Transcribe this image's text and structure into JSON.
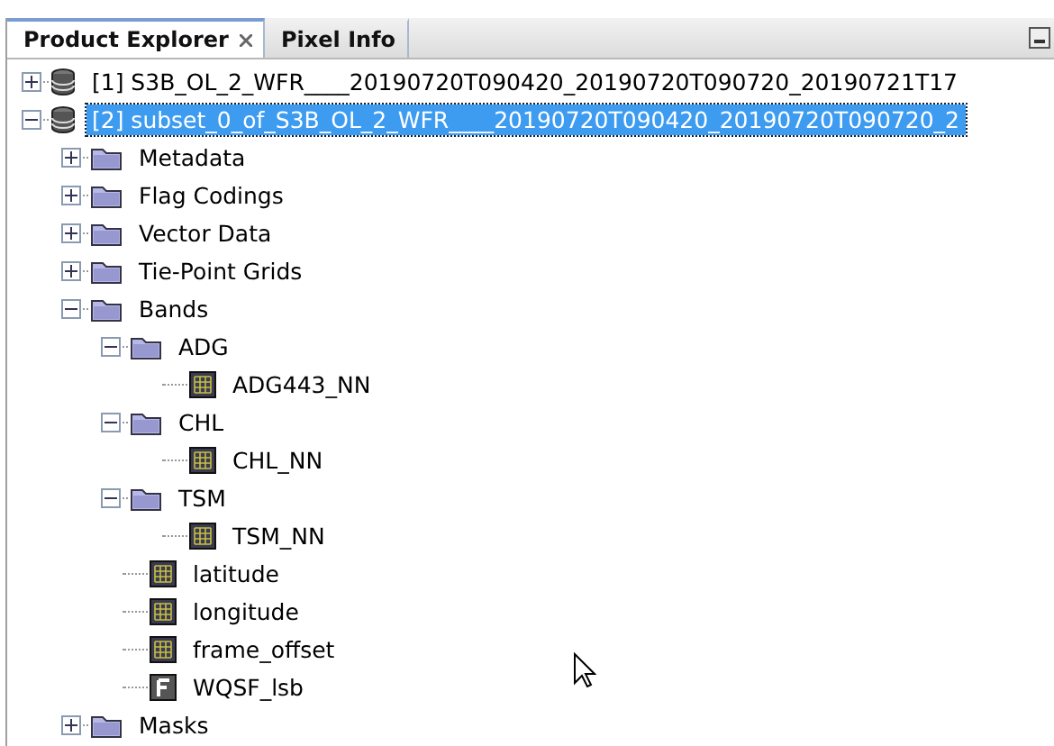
{
  "tabs": [
    {
      "label": "Product Explorer",
      "selected": true,
      "closable": true
    },
    {
      "label": "Pixel Info",
      "selected": false,
      "closable": false
    }
  ],
  "tree": [
    {
      "kind": "product",
      "label": "[1] S3B_OL_2_WFR____20190720T090420_20190720T090720_20190721T17",
      "expanded": false,
      "selected": false
    },
    {
      "kind": "product",
      "label": "[2] subset_0_of_S3B_OL_2_WFR____20190720T090420_20190720T090720_2",
      "expanded": true,
      "selected": true,
      "children": [
        {
          "kind": "folder",
          "label": "Metadata",
          "expanded": false,
          "selected": false
        },
        {
          "kind": "folder",
          "label": "Flag Codings",
          "expanded": false,
          "selected": false
        },
        {
          "kind": "folder",
          "label": "Vector Data",
          "expanded": false,
          "selected": false
        },
        {
          "kind": "folder",
          "label": "Tie-Point Grids",
          "expanded": false,
          "selected": false
        },
        {
          "kind": "folder",
          "label": "Bands",
          "expanded": true,
          "selected": false,
          "children": [
            {
              "kind": "folder",
              "label": "ADG",
              "expanded": true,
              "selected": false,
              "children": [
                {
                  "kind": "band",
                  "label": "ADG443_NN",
                  "selected": false
                }
              ]
            },
            {
              "kind": "folder",
              "label": "CHL",
              "expanded": true,
              "selected": false,
              "children": [
                {
                  "kind": "band",
                  "label": "CHL_NN",
                  "selected": false
                }
              ]
            },
            {
              "kind": "folder",
              "label": "TSM",
              "expanded": true,
              "selected": false,
              "children": [
                {
                  "kind": "band",
                  "label": "TSM_NN",
                  "selected": false
                }
              ]
            },
            {
              "kind": "band",
              "label": "latitude",
              "selected": false
            },
            {
              "kind": "band",
              "label": "longitude",
              "selected": false
            },
            {
              "kind": "band",
              "label": "frame_offset",
              "selected": false
            },
            {
              "kind": "flag",
              "label": "WQSF_lsb",
              "selected": false
            }
          ]
        },
        {
          "kind": "folder",
          "label": "Masks",
          "expanded": false,
          "selected": false
        }
      ]
    }
  ]
}
